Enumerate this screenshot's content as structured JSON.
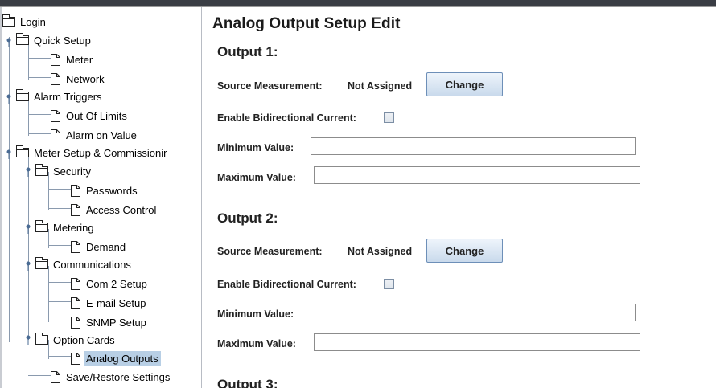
{
  "tree": {
    "root": "Login",
    "items": [
      {
        "label": "Quick Setup"
      },
      {
        "label": "Meter"
      },
      {
        "label": "Network"
      },
      {
        "label": "Alarm Triggers"
      },
      {
        "label": "Out Of Limits"
      },
      {
        "label": "Alarm on Value"
      },
      {
        "label": "Meter Setup & Commissionir"
      },
      {
        "label": "Security"
      },
      {
        "label": "Passwords"
      },
      {
        "label": "Access Control"
      },
      {
        "label": "Metering"
      },
      {
        "label": "Demand"
      },
      {
        "label": "Communications"
      },
      {
        "label": "Com 2 Setup"
      },
      {
        "label": "E-mail Setup"
      },
      {
        "label": "SNMP Setup"
      },
      {
        "label": "Option Cards"
      },
      {
        "label": "Analog Outputs"
      },
      {
        "label": "Save/Restore Settings"
      }
    ],
    "selected": "Analog Outputs"
  },
  "main": {
    "title": "Analog Output Setup Edit",
    "outputs": [
      {
        "heading": "Output 1:",
        "source_label": "Source Measurement:",
        "source_value": "Not Assigned",
        "change_label": "Change",
        "bidir_label": "Enable Bidirectional Current:",
        "bidir_checked": false,
        "min_label": "Minimum Value:",
        "min_value": "",
        "max_label": "Maximum Value:",
        "max_value": ""
      },
      {
        "heading": "Output 2:",
        "source_label": "Source Measurement:",
        "source_value": "Not Assigned",
        "change_label": "Change",
        "bidir_label": "Enable Bidirectional Current:",
        "bidir_checked": false,
        "min_label": "Minimum Value:",
        "min_value": "",
        "max_label": "Maximum Value:",
        "max_value": ""
      },
      {
        "heading": "Output 3:"
      }
    ]
  },
  "colors": {
    "selection": "#b8cfe5",
    "button_border": "#6d8fb8",
    "tree_line": "#8a9aae"
  }
}
